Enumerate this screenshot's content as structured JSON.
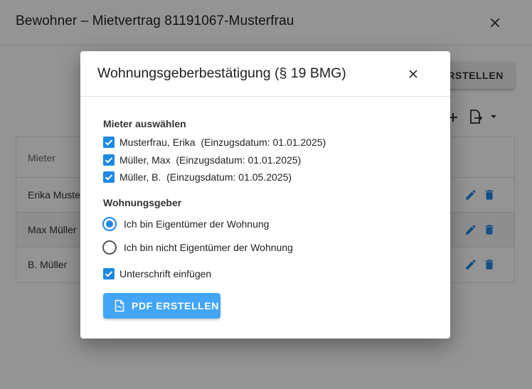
{
  "background": {
    "title": "Bewohner – Mietvertrag 81191067-Musterfrau",
    "create_button_label": "ERSTELLEN",
    "table": {
      "column_header": "Mieter",
      "rows": [
        {
          "name": "Erika Muste"
        },
        {
          "name": "Max Müller"
        },
        {
          "name": "B. Müller"
        }
      ]
    }
  },
  "dialog": {
    "title": "Wohnungsgeberbestätigung (§ 19 BMG)",
    "tenants_label": "Mieter auswählen",
    "tenants": [
      {
        "label": "Musterfrau, Erika  (Einzugsdatum: 01.01.2025)",
        "checked": true
      },
      {
        "label": "Müller, Max  (Einzugsdatum: 01.01.2025)",
        "checked": true
      },
      {
        "label": "Müller, B.  (Einzugsdatum: 01.05.2025)",
        "checked": true
      }
    ],
    "landlord_label": "Wohnungsgeber",
    "landlord_options": [
      {
        "label": "Ich bin Eigentümer der Wohnung",
        "selected": true
      },
      {
        "label": "Ich bin nicht Eigentümer der Wohnung",
        "selected": false
      }
    ],
    "signature": {
      "label": "Unterschrift einfügen",
      "checked": true
    },
    "pdf_button_label": "PDF ERSTELLEN"
  },
  "colors": {
    "accent": "#1e88e5",
    "button": "#42a5f5",
    "overlay": "rgba(0,0,0,0.42)"
  },
  "icons": [
    "close-icon",
    "add-icon",
    "export-icon",
    "dropdown-arrow-icon",
    "edit-icon",
    "delete-icon",
    "pdf-file-icon",
    "checkmark-icon"
  ]
}
